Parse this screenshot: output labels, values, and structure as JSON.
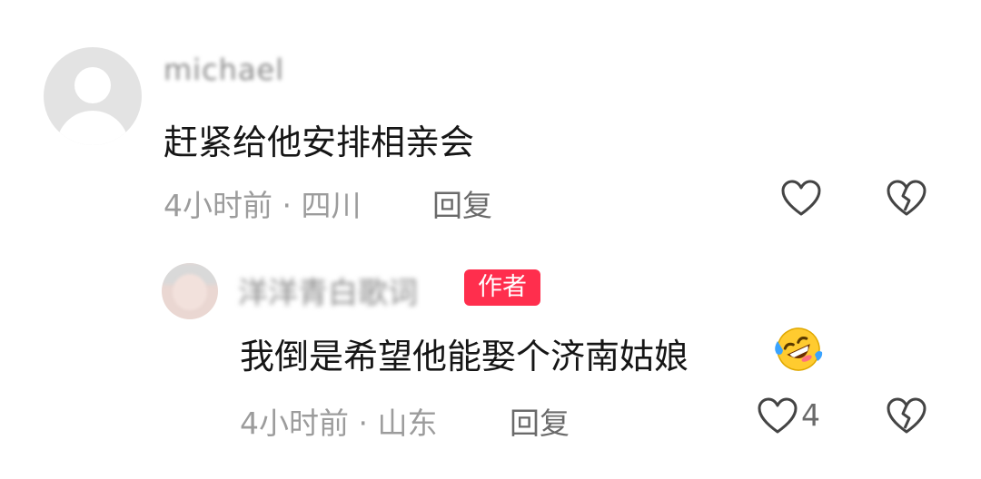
{
  "comment": {
    "username": "michael",
    "text": "赶紧给他安排相亲会",
    "time": "4小时前",
    "separator": "·",
    "location": "四川",
    "reply_label": "回复"
  },
  "reply": {
    "username": "洋洋青白歌词",
    "badge": "作者",
    "text": "我倒是希望他能娶个济南姑娘",
    "emoji_name": "rofl-emoji",
    "time": "4小时前",
    "separator": "·",
    "location": "山东",
    "reply_label": "回复",
    "like_count": "4"
  },
  "colors": {
    "text_primary": "#161616",
    "text_meta": "#9c9c9c",
    "badge_bg": "#ff2e4d",
    "icon_stroke": "#444444"
  },
  "icons": [
    "heart-icon",
    "broken-heart-icon"
  ]
}
